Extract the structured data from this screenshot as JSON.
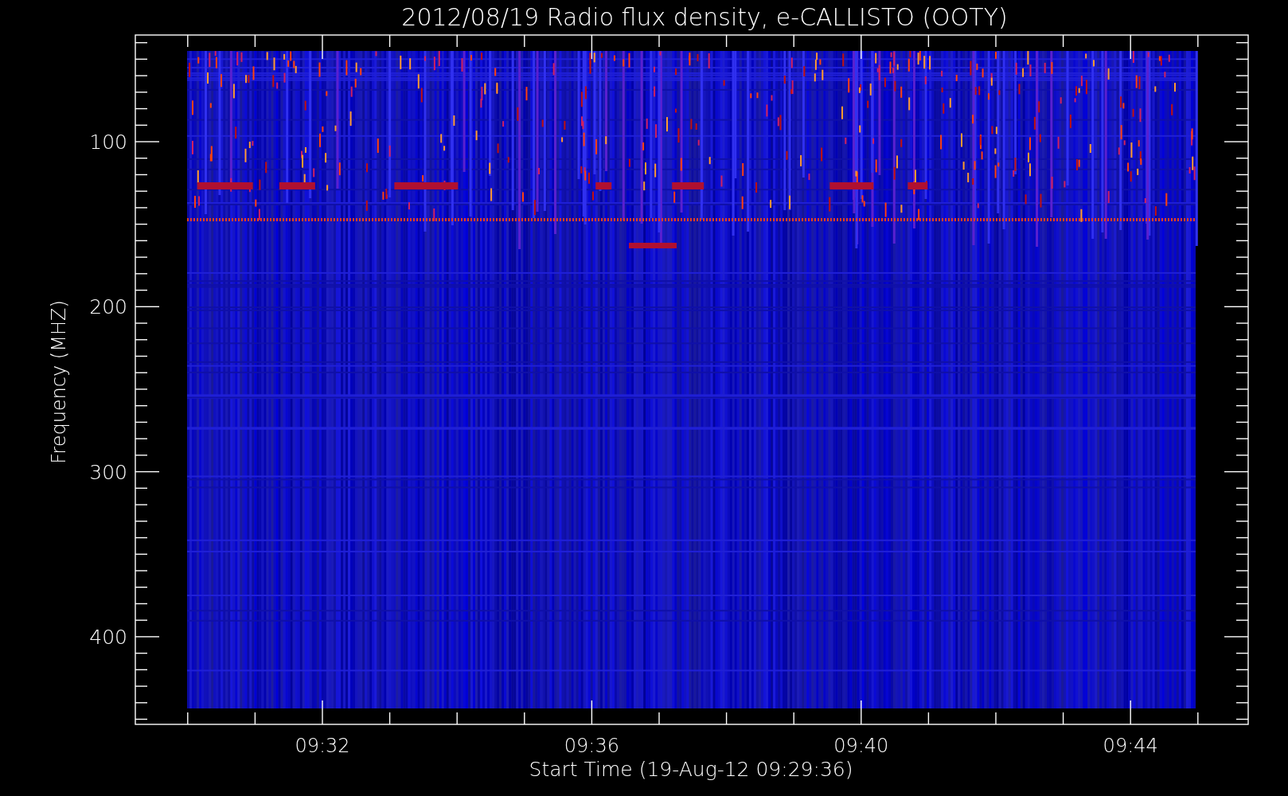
{
  "title": "2012/08/19  Radio flux density, e-CALLISTO (OOTY)",
  "y_axis": {
    "label": "Frequency (MHZ)",
    "ticks": [
      "100",
      "200",
      "300",
      "400"
    ]
  },
  "x_axis": {
    "label": "Start Time (19-Aug-12 09:29:36)",
    "ticks": [
      "09:32",
      "09:36",
      "09:40",
      "09:44"
    ]
  }
}
